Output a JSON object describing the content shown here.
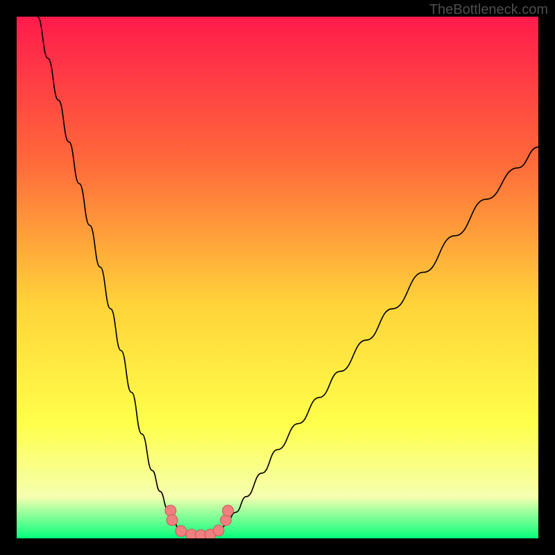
{
  "watermark": "TheBottleneck.com",
  "colors": {
    "gradient_top": "#ff1b4c",
    "gradient_mid_upper": "#ff6a3a",
    "gradient_mid": "#ffd33a",
    "gradient_mid_lower": "#ffff4a",
    "gradient_lower": "#f6ffb0",
    "gradient_bottom": "#07ff7c",
    "curve": "#000000",
    "markers_fill": "#f08080",
    "markers_stroke": "#cd5c5c",
    "frame": "#000000"
  },
  "chart_data": {
    "type": "line",
    "title": "",
    "xlabel": "",
    "ylabel": "",
    "xlim": [
      0,
      100
    ],
    "ylim": [
      0,
      100
    ],
    "series": [
      {
        "name": "left-branch",
        "x": [
          4,
          6,
          8,
          10,
          12,
          14,
          16,
          18,
          20,
          22,
          24,
          26,
          27.5,
          29,
          30,
          31,
          31.8
        ],
        "values": [
          100,
          92,
          84,
          76,
          68,
          60,
          52,
          44,
          36,
          28,
          20,
          13,
          9,
          5.5,
          3.5,
          2,
          1
        ]
      },
      {
        "name": "valley-floor",
        "x": [
          31.8,
          33,
          34.5,
          36,
          37.5,
          38.8
        ],
        "values": [
          1,
          0.6,
          0.5,
          0.5,
          0.6,
          1
        ]
      },
      {
        "name": "right-branch",
        "x": [
          38.8,
          40,
          42,
          44,
          47,
          50,
          54,
          58,
          62,
          67,
          72,
          78,
          84,
          90,
          96,
          100
        ],
        "values": [
          1,
          2.5,
          5,
          8,
          12.5,
          17,
          22,
          27,
          32,
          38,
          44,
          51,
          58,
          65,
          71,
          75
        ]
      }
    ],
    "markers": {
      "name": "valley-markers",
      "points": [
        {
          "x": 29.5,
          "y": 5.3
        },
        {
          "x": 29.8,
          "y": 3.5
        },
        {
          "x": 31.5,
          "y": 1.4
        },
        {
          "x": 33.5,
          "y": 0.7
        },
        {
          "x": 35.3,
          "y": 0.6
        },
        {
          "x": 37.1,
          "y": 0.7
        },
        {
          "x": 38.7,
          "y": 1.5
        },
        {
          "x": 40.1,
          "y": 3.5
        },
        {
          "x": 40.5,
          "y": 5.3
        }
      ]
    }
  }
}
